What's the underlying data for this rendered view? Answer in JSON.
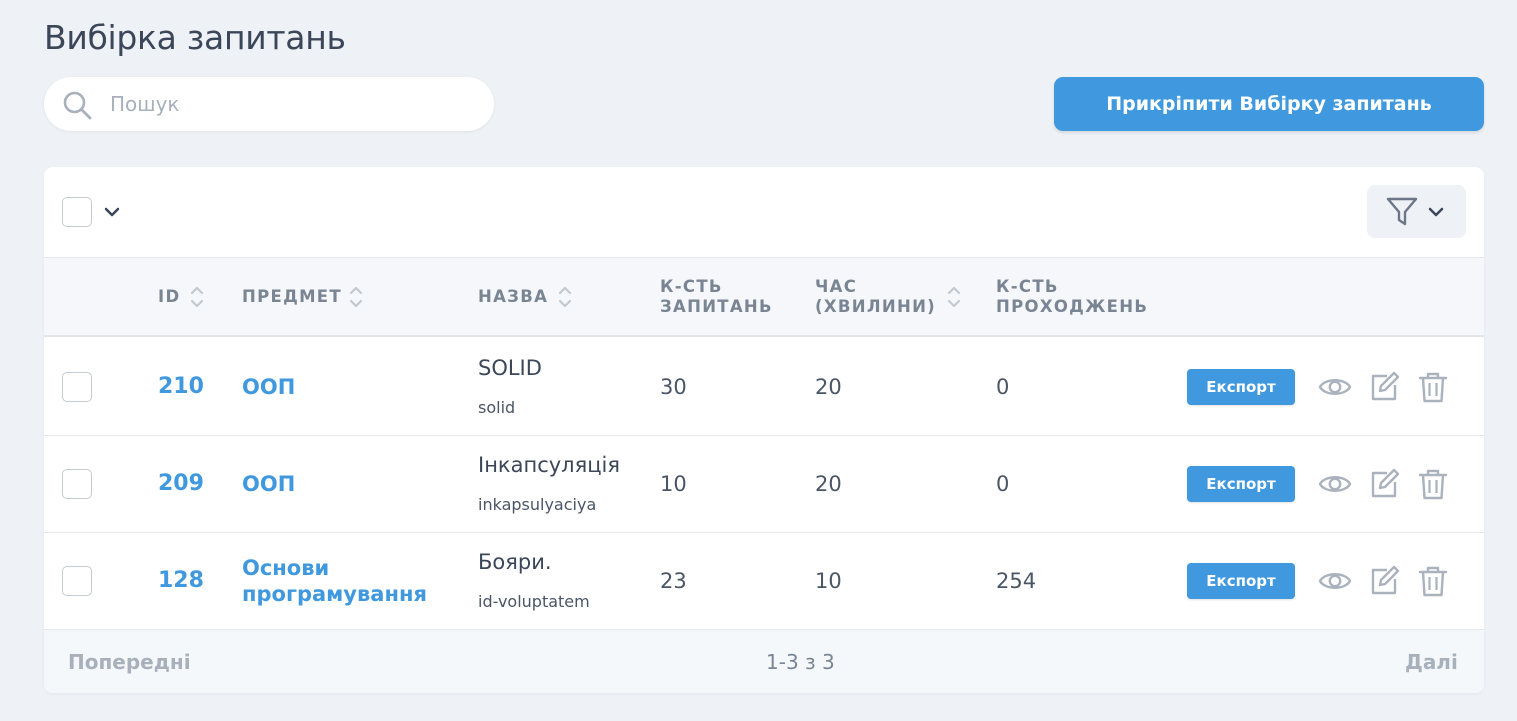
{
  "page": {
    "title": "Вибірка запитань"
  },
  "search": {
    "placeholder": "Пошук"
  },
  "actions": {
    "attach_label": "Прикріпити Вибірку запитань"
  },
  "table": {
    "columns": {
      "id": "ID",
      "subject": "ПРЕДМЕТ",
      "name": "НАЗВА",
      "questions_l1": "К-СТЬ",
      "questions_l2": "ЗАПИТАНЬ",
      "time_l1": "ЧАС",
      "time_l2": "(ХВИЛИНИ)",
      "passes_l1": "К-СТЬ",
      "passes_l2": "ПРОХОДЖЕНЬ"
    },
    "rows": [
      {
        "id": "210",
        "subject": "ООП",
        "name": "SOLID",
        "slug": "solid",
        "questions": "30",
        "time": "20",
        "passes": "0",
        "export": "Експорт"
      },
      {
        "id": "209",
        "subject": "ООП",
        "name": "Інкапсуляція",
        "slug": "inkapsulyaciya",
        "questions": "10",
        "time": "20",
        "passes": "0",
        "export": "Експорт"
      },
      {
        "id": "128",
        "subject": "Основи програмування",
        "name": "Бояри.",
        "slug": "id-voluptatem",
        "questions": "23",
        "time": "10",
        "passes": "254",
        "export": "Експорт"
      }
    ]
  },
  "pagination": {
    "prev": "Попередні",
    "info": "1-3 з 3",
    "next": "Далі"
  },
  "icons": {
    "search": "search-icon",
    "chevron": "chevron-down-icon",
    "filter": "filter-icon",
    "sort": "sort-icon",
    "view": "eye-icon",
    "edit": "edit-icon",
    "delete": "trash-icon"
  },
  "colors": {
    "accent": "#4099de",
    "background": "#eef1f5",
    "header_text": "#7a8594"
  }
}
